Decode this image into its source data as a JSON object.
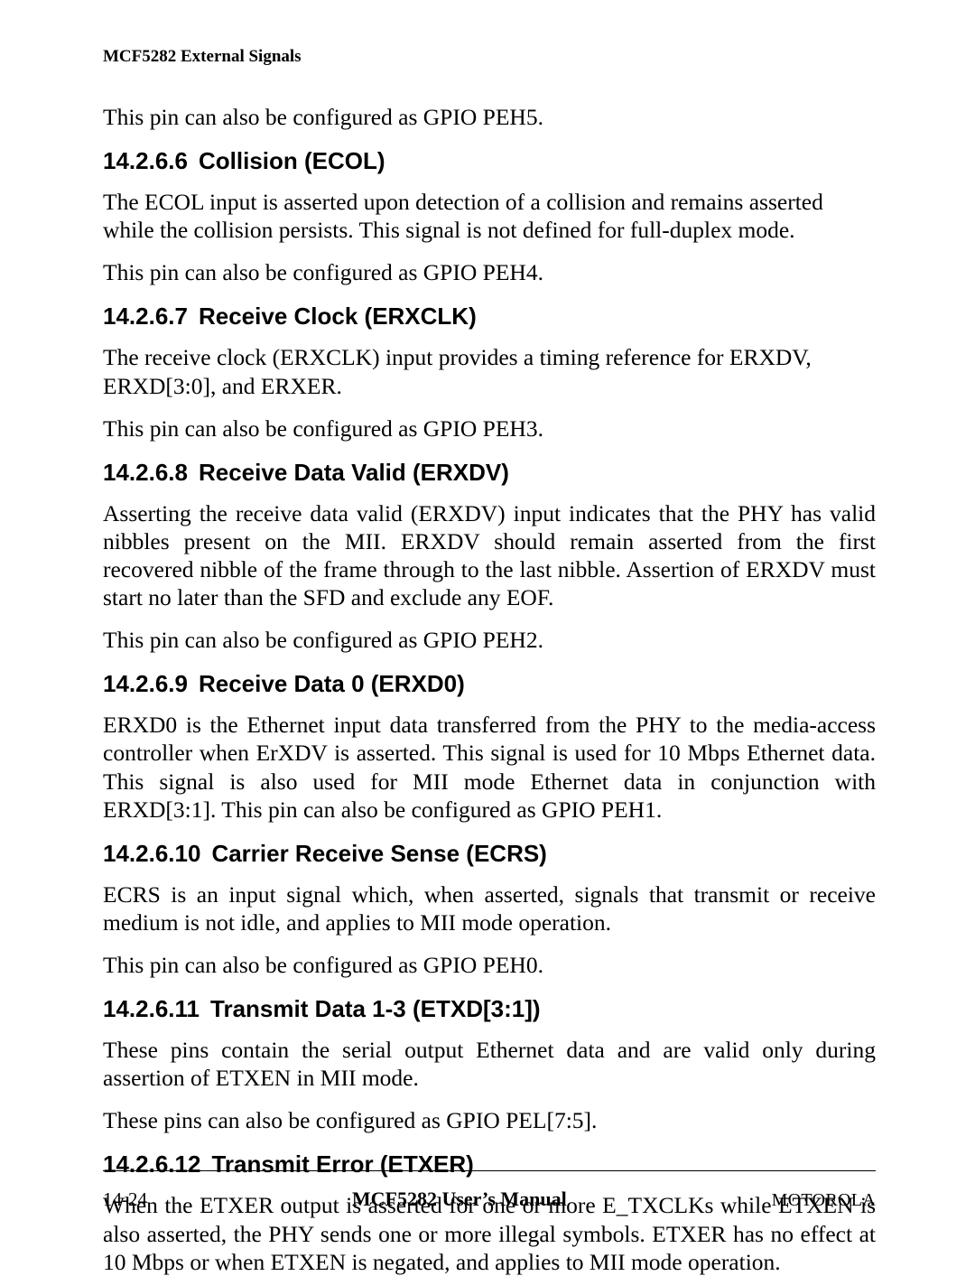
{
  "header": {
    "running": "MCF5282 External Signals"
  },
  "intro_para": "This pin can also be configured as GPIO PEH5.",
  "sections": [
    {
      "num": "14.2.6.6",
      "title": "Collision (ECOL)",
      "paras": [
        "The ECOL input is asserted upon detection of a collision and remains asserted while the collision persists.  This signal is not defined for full-duplex mode.",
        "This pin can also be configured as GPIO PEH4."
      ],
      "justify": [
        false,
        false
      ]
    },
    {
      "num": "14.2.6.7",
      "title": "Receive Clock (ERXCLK)",
      "paras": [
        "The receive clock (ERXCLK) input provides a timing reference for ERXDV, ERXD[3:0], and ERXER.",
        "This pin can also be configured as GPIO PEH3."
      ],
      "justify": [
        false,
        false
      ]
    },
    {
      "num": "14.2.6.8",
      "title": "Receive Data Valid (ERXDV)",
      "paras": [
        "Asserting the receive data valid (ERXDV) input indicates that the PHY has valid nibbles present on the MII.  ERXDV should remain asserted from the first recovered nibble of the frame through to the last nibble. Assertion of ERXDV must start no later than the SFD and exclude any EOF.",
        "This pin can also be configured as GPIO PEH2."
      ],
      "justify": [
        true,
        false
      ]
    },
    {
      "num": "14.2.6.9",
      "title": "Receive Data 0 (ERXD0)",
      "paras": [
        "ERXD0 is the Ethernet input data transferred from the PHY to the media-access controller when ErXDV is asserted. This signal is used for 10 Mbps Ethernet data.  This signal is also used for MII mode Ethernet data in conjunction with ERXD[3:1]. This pin can also be configured as GPIO PEH1."
      ],
      "justify": [
        true
      ]
    },
    {
      "num": "14.2.6.10",
      "title": "Carrier Receive Sense (ECRS)",
      "paras": [
        "ECRS is an input signal which, when asserted, signals that transmit or receive medium is not idle, and applies to MII mode operation.",
        "This pin can also be configured as GPIO PEH0."
      ],
      "justify": [
        true,
        false
      ]
    },
    {
      "num": "14.2.6.11",
      "title": "Transmit Data 1-3 (ETXD[3:1])",
      "paras": [
        "These pins contain the serial output Ethernet data and are valid only during assertion of ETXEN in MII mode.",
        "These pins can also be configured as GPIO PEL[7:5]."
      ],
      "justify": [
        true,
        false
      ]
    },
    {
      "num": "14.2.6.12",
      "title": "Transmit Error (ETXER)",
      "paras": [
        "When the ETXER output is asserted for one or more E_TXCLKs while ETXEN is also asserted, the PHY sends one or more illegal symbols. ETXER has no effect at 10 Mbps or when ETXEN is negated, and applies to MII mode operation."
      ],
      "justify": [
        true
      ]
    }
  ],
  "footer": {
    "left": "14-24",
    "center": "MCF5282 User’s Manual",
    "right": "MOTOROLA"
  }
}
